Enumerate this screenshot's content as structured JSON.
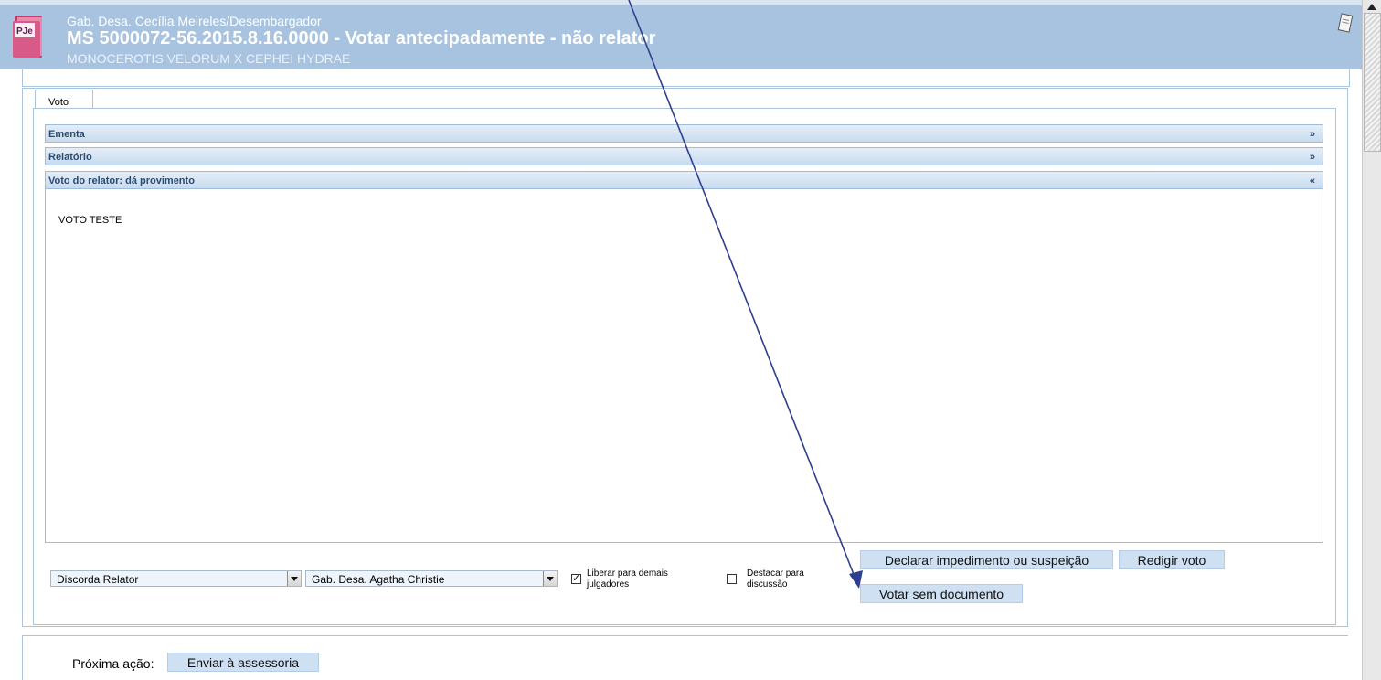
{
  "header": {
    "office": "Gab. Desa. Cecília Meireles/Desembargador",
    "title": "MS 5000072-56.2015.8.16.0000 - Votar antecipadamente - não relator",
    "parties": "MONOCEROTIS VELORUM X CEPHEI HYDRAE",
    "logo_text": "PJe"
  },
  "tab": {
    "label": "Voto"
  },
  "sections": [
    {
      "label": "Ementa",
      "chevron": "»"
    },
    {
      "label": "Relatório",
      "chevron": "»"
    },
    {
      "label": "Voto do relator: dá provimento",
      "chevron": "«"
    }
  ],
  "content": {
    "text": "VOTO TESTE"
  },
  "controls": {
    "vote_select": "Discorda Relator",
    "office_select": "Gab. Desa. Agatha Christie",
    "release_checkbox": {
      "checked": true,
      "mark": "✓",
      "label_line1": "Liberar para demais",
      "label_line2": "julgadores"
    },
    "highlight_checkbox": {
      "checked": false,
      "label_line1": "Destacar para",
      "label_line2": "discussão"
    },
    "declare_button": "Declarar impedimento ou suspeição",
    "draft_button": "Redigir voto",
    "vote_no_doc_button": "Votar sem documento"
  },
  "footer": {
    "next_action_label": "Próxima ação:",
    "send_button": "Enviar à assessoria"
  },
  "colors": {
    "header_bg": "#a7c3e0",
    "button_bg": "#cfe0f2",
    "annotation_arrow": "#2e3f8f"
  }
}
